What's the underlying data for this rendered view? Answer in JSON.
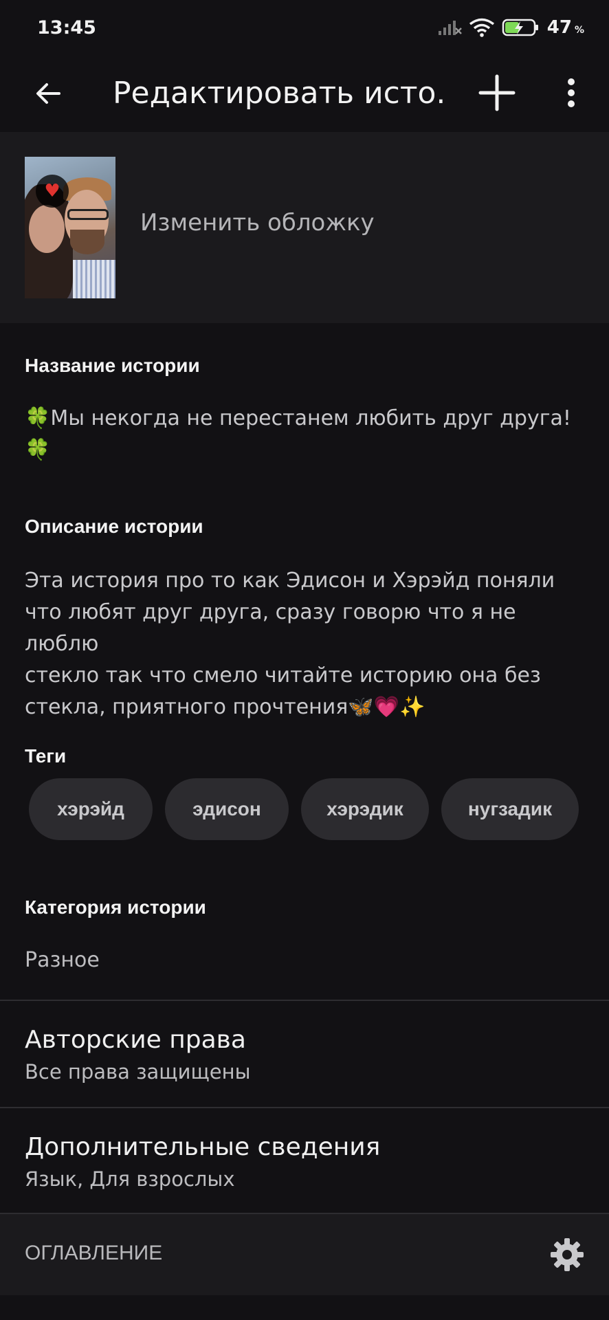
{
  "status_bar": {
    "time": "13:45",
    "battery_percent": "47",
    "battery_unit": "%"
  },
  "app_bar": {
    "title": "Редактировать исто...",
    "back_icon": "arrow-left-icon",
    "add_icon": "plus-icon",
    "more_icon": "more-vertical-icon"
  },
  "cover": {
    "change_label": "Изменить обложку"
  },
  "story_title": {
    "label": "Название истории",
    "value_line1": "🍀Мы некогда не перестанем любить друг друга!",
    "value_line2": "🍀"
  },
  "story_description": {
    "label": "Описание истории",
    "line1": "Эта история про то как Эдисон и Хэрэйд поняли",
    "line2": "что любят друг друга, сразу говорю что я не люблю",
    "line3": "стекло так что смело читайте историю она без",
    "line4": "стекла, приятного прочтения🦋💗✨"
  },
  "tags": {
    "label": "Теги",
    "items": [
      "хэрэйд",
      "эдисон",
      "хэрэдик",
      "нугзадик"
    ]
  },
  "category": {
    "label": "Категория истории",
    "value": "Разное"
  },
  "copyright": {
    "title": "Авторские права",
    "subtitle": "Все права защищены"
  },
  "additional": {
    "title": "Дополнительные сведения",
    "subtitle": "Язык, Для взрослых"
  },
  "toc": {
    "label": "ОГЛАВЛЕНИЕ",
    "settings_icon": "gear-icon"
  },
  "colors": {
    "background": "#121114",
    "panel": "#1b1a1d",
    "tag_bg": "#2c2b2f",
    "battery_accent": "#7ed957"
  }
}
